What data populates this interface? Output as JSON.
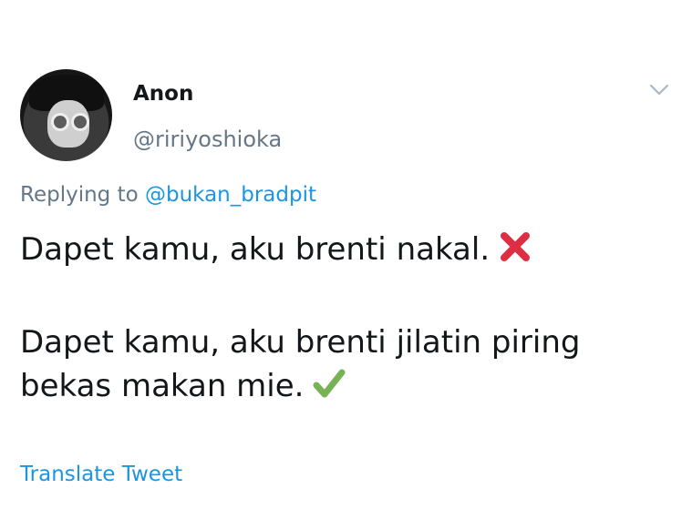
{
  "author": {
    "name": "Anon",
    "handle": "@ririyoshioka"
  },
  "reply": {
    "prefix": "Replying to",
    "mention": "@bukan_bradpit"
  },
  "tweet": {
    "line1": "Dapet kamu, aku brenti nakal.",
    "line1_icon": "cross-mark-icon",
    "line2": "Dapet kamu, aku brenti jilatin piring bekas makan mie.",
    "line2_icon": "check-mark-icon"
  },
  "translate_label": "Translate Tweet",
  "colors": {
    "link": "#1b95e0",
    "muted": "#657786",
    "text": "#14171a",
    "cross": "#dd2e44",
    "check": "#77b255"
  }
}
